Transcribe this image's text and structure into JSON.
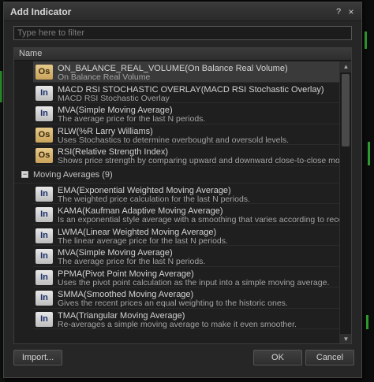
{
  "window": {
    "title": "Add Indicator",
    "help_label": "?",
    "close_label": "×"
  },
  "filter": {
    "placeholder": "Type here to filter",
    "value": ""
  },
  "list": {
    "column_header": "Name",
    "items_top": [
      {
        "badge": "Os",
        "name": "ON_BALANCE_REAL_VOLUME(On Balance Real Volume)",
        "desc": "On Balance Real Volume",
        "selected": true
      },
      {
        "badge": "In",
        "name": "MACD RSI STOCHASTIC OVERLAY(MACD RSI Stochastic Overlay)",
        "desc": "MACD RSI Stochastic Overlay"
      },
      {
        "badge": "In",
        "name": "MVA(Simple Moving Average)",
        "desc": "The average price for the last N periods."
      },
      {
        "badge": "Os",
        "name": "RLW(%R Larry Williams)",
        "desc": "Uses Stochastics to determine overbought and oversold levels."
      },
      {
        "badge": "Os",
        "name": "RSI(Relative Strength Index)",
        "desc": "Shows price strength by comparing upward and downward close-to-close move"
      }
    ],
    "group": {
      "toggle": "−",
      "label": "Moving Averages (9)"
    },
    "items_group": [
      {
        "badge": "In",
        "name": "EMA(Exponential Weighted Moving Average)",
        "desc": "The weighted price calculation for the last N periods."
      },
      {
        "badge": "In",
        "name": "KAMA(Kaufman Adaptive Moving Average)",
        "desc": "Is an exponential style average with a smoothing that varies according to recer"
      },
      {
        "badge": "In",
        "name": "LWMA(Linear Weighted Moving Average)",
        "desc": "The linear average price for the last N periods."
      },
      {
        "badge": "In",
        "name": "MVA(Simple Moving Average)",
        "desc": "The average price for the last N periods."
      },
      {
        "badge": "In",
        "name": "PPMA(Pivot Point Moving Average)",
        "desc": "Uses the pivot point calculation as the input into a simple moving average."
      },
      {
        "badge": "In",
        "name": "SMMA(Smoothed Moving Average)",
        "desc": "Gives the recent prices an equal weighting to the historic ones."
      },
      {
        "badge": "In",
        "name": "TMA(Triangular Moving Average)",
        "desc": "Re-averages a simple moving average to make it even smoother."
      }
    ]
  },
  "buttons": {
    "import": "Import...",
    "ok": "OK",
    "cancel": "Cancel"
  },
  "colors": {
    "accent_badge_os": "#d4b06a",
    "accent_badge_in": "#d0d0d0",
    "background": "#262626"
  }
}
